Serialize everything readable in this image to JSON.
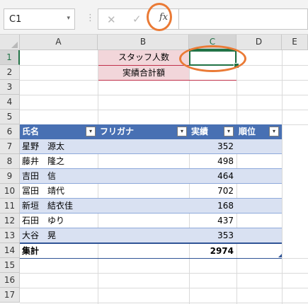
{
  "formula_bar": {
    "name_box": "C1",
    "name_box_arrow": "▾",
    "separator": "⋮",
    "cancel_icon": "✕",
    "enter_icon": "✓",
    "fx_label": "fx",
    "formula": ""
  },
  "columns": [
    "A",
    "B",
    "C",
    "D",
    "E"
  ],
  "rows": [
    "1",
    "2",
    "3",
    "4",
    "5",
    "6",
    "7",
    "8",
    "9",
    "10",
    "11",
    "12",
    "13",
    "14",
    "15",
    "16",
    "17"
  ],
  "labels": {
    "staff_count": "スタッフ人数",
    "total_sales": "実績合計額"
  },
  "table": {
    "headers": [
      "氏名",
      "フリガナ",
      "実績",
      "順位"
    ],
    "filter_icon": "▾",
    "rows": [
      {
        "name": "星野　源太",
        "kana": "",
        "sales": "352",
        "rank": ""
      },
      {
        "name": "藤井　隆之",
        "kana": "",
        "sales": "498",
        "rank": ""
      },
      {
        "name": "吉田　信",
        "kana": "",
        "sales": "464",
        "rank": ""
      },
      {
        "name": "冨田　靖代",
        "kana": "",
        "sales": "702",
        "rank": ""
      },
      {
        "name": "新垣　結衣佳",
        "kana": "",
        "sales": "168",
        "rank": ""
      },
      {
        "name": "石田　ゆり",
        "kana": "",
        "sales": "437",
        "rank": ""
      },
      {
        "name": "大谷　晃",
        "kana": "",
        "sales": "353",
        "rank": ""
      }
    ],
    "total_label": "集計",
    "total_value": "2974"
  },
  "colors": {
    "accent_green": "#217346",
    "annotation_orange": "#ea7a35",
    "table_header_blue": "#4870b3",
    "band_blue": "#d9e1f2",
    "label_pink": "#f2d6da"
  }
}
